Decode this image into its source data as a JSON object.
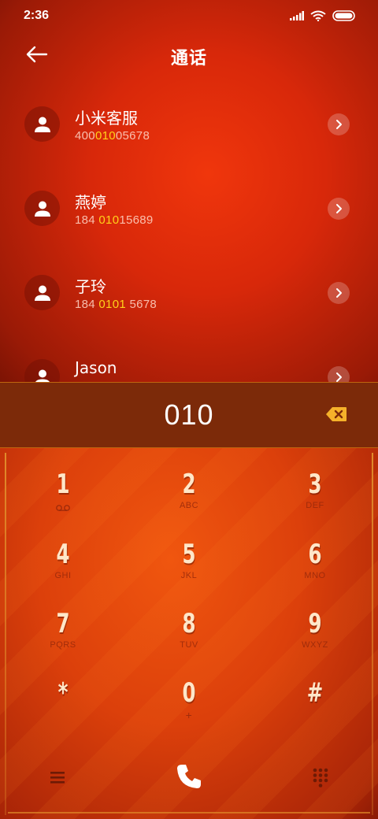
{
  "status": {
    "time": "2:36"
  },
  "header": {
    "title": "通话"
  },
  "contacts": [
    {
      "name": "小米客服",
      "num_pre": "400",
      "num_hl": "010",
      "num_post": "05678"
    },
    {
      "name": "燕婷",
      "num_pre": "184 ",
      "num_hl": "010",
      "num_post": "15689"
    },
    {
      "name": "子玲",
      "num_pre": "184 ",
      "num_hl": "0101",
      "num_post": " 5678"
    },
    {
      "name": "Jason",
      "num_pre": "",
      "num_hl": "",
      "num_post": ""
    }
  ],
  "dial": {
    "input": "010"
  },
  "keys": [
    {
      "digit": "1",
      "letters": ""
    },
    {
      "digit": "2",
      "letters": "ABC"
    },
    {
      "digit": "3",
      "letters": "DEF"
    },
    {
      "digit": "4",
      "letters": "GHI"
    },
    {
      "digit": "5",
      "letters": "JKL"
    },
    {
      "digit": "6",
      "letters": "MNO"
    },
    {
      "digit": "7",
      "letters": "PQRS"
    },
    {
      "digit": "8",
      "letters": "TUV"
    },
    {
      "digit": "9",
      "letters": "WXYZ"
    },
    {
      "digit": "*",
      "letters": ""
    },
    {
      "digit": "0",
      "letters": "+"
    },
    {
      "digit": "#",
      "letters": ""
    }
  ],
  "icons": {
    "back": "arrow-left-icon",
    "avatar": "person-icon",
    "chevron": "chevron-right-icon",
    "backspace": "backspace-icon",
    "voicemail": "voicemail-icon",
    "menu": "menu-icon",
    "call": "phone-icon",
    "dialpad": "dialpad-icon"
  },
  "colors": {
    "highlight": "#ffd21a",
    "backspace": "#f5b12a",
    "input_bar": "#7c2a09"
  }
}
